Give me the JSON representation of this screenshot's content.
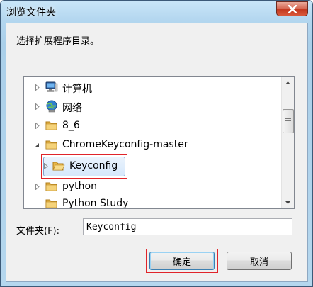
{
  "window": {
    "title": "浏览文件夹"
  },
  "prompt": "选择扩展程序目录。",
  "tree": {
    "items": [
      {
        "label": "计算机",
        "icon": "computer-icon",
        "expander": "collapsed"
      },
      {
        "label": "网络",
        "icon": "network-icon",
        "expander": "collapsed"
      },
      {
        "label": "8_6",
        "icon": "folder-icon",
        "expander": "collapsed"
      },
      {
        "label": "ChromeKeyconfig-master",
        "icon": "folder-icon",
        "expander": "expanded"
      },
      {
        "label": "Keyconfig",
        "icon": "folder-open-icon",
        "expander": "collapsed",
        "selected": true
      },
      {
        "label": "python",
        "icon": "folder-icon",
        "expander": "collapsed"
      },
      {
        "label": "Python Study",
        "icon": "folder-icon",
        "expander": "none"
      }
    ]
  },
  "folder_field": {
    "label": "文件夹(F):",
    "value": "Keyconfig"
  },
  "buttons": {
    "ok": "确定",
    "cancel": "取消"
  },
  "colors": {
    "highlight_box": "#e0242a",
    "folder": "#e8b84a",
    "selection": "#d6e8fb"
  }
}
